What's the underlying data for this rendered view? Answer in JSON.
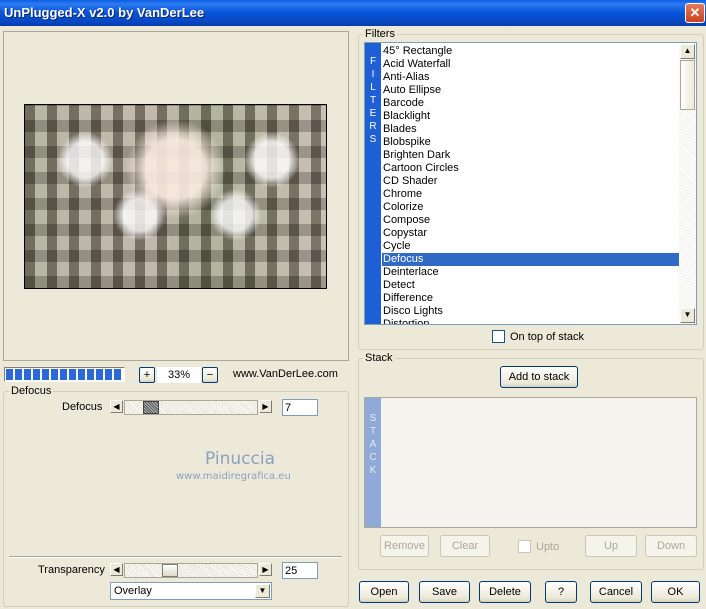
{
  "window": {
    "title": "UnPlugged-X v2.0 by VanDerLee"
  },
  "preview": {
    "zoom_label": "33%",
    "website": "www.VanDerLee.com"
  },
  "filter_settings": {
    "group_label": "Defocus",
    "param_label": "Defocus",
    "param_value": "7",
    "transparency_label": "Transparency",
    "transparency_value": "25",
    "transparency_level": 0.25,
    "blend_mode": "Overlay"
  },
  "watermark": {
    "name": "Pinuccia",
    "url": "www.maidiregrafica.eu"
  },
  "filters": {
    "group_label": "Filters",
    "side_label": "FILTERS",
    "items": [
      "45° Rectangle",
      "Acid Waterfall",
      "Anti-Alias",
      "Auto Ellipse",
      "Barcode",
      "Blacklight",
      "Blades",
      "Blobspike",
      "Brighten Dark",
      "Cartoon Circles",
      "CD Shader",
      "Chrome",
      "Colorize",
      "Compose",
      "Copystar",
      "Cycle",
      "Defocus",
      "Deinterlace",
      "Detect",
      "Difference",
      "Disco Lights",
      "Distortion"
    ],
    "selected": "Defocus",
    "on_top_label": "On top of stack"
  },
  "stack": {
    "group_label": "Stack",
    "side_label": "STACK",
    "add_label": "Add to stack",
    "remove_label": "Remove",
    "clear_label": "Clear",
    "upto_label": "Upto",
    "up_label": "Up",
    "down_label": "Down"
  },
  "footer": {
    "open": "Open",
    "save": "Save",
    "delete": "Delete",
    "help": "?",
    "cancel": "Cancel",
    "ok": "OK"
  },
  "colors": {
    "accent": "#1f5fd6",
    "selection": "#316ac5",
    "progress": "#2b68d9"
  }
}
